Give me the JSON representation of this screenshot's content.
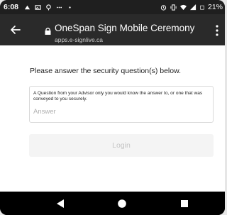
{
  "status_bar": {
    "time": "6:08",
    "battery": "21%",
    "icons": [
      "notification-icon",
      "image-icon",
      "location-icon",
      "dots-icon",
      "alarm-icon",
      "vibrate-icon",
      "wifi-icon",
      "signal-icon",
      "battery-icon"
    ]
  },
  "app_bar": {
    "title": "OneSpan Sign Mobile Ceremony",
    "url": "apps.e-signlive.ca",
    "back_icon": "arrow-left-icon",
    "menu_icon": "kebab-menu-icon"
  },
  "content": {
    "prompt": "Please answer the security question(s) below.",
    "question": "A Question from your Advisor only you would know the answer to, or one that was conveyed to you securely.",
    "answer_value": "",
    "answer_placeholder": "Answer",
    "login_label": "Login"
  },
  "colors": {
    "status_bar_bg": "#1f1f1f",
    "app_bar_bg": "#2a2a2a",
    "login_disabled_bg": "#f4f4f4",
    "login_disabled_text": "#c4c4c4"
  }
}
